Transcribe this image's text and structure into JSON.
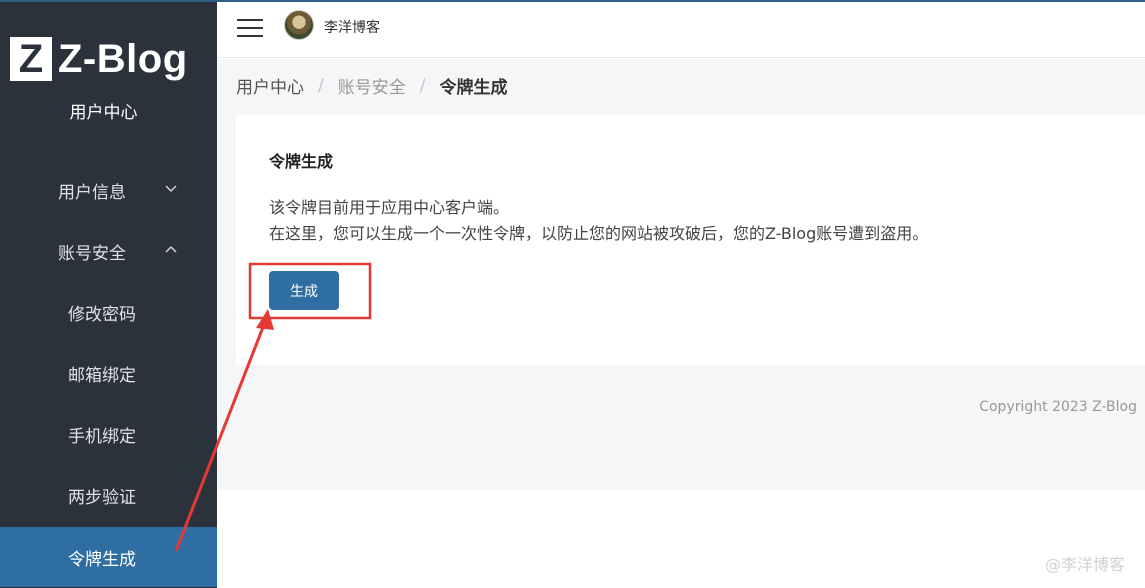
{
  "logo": {
    "mark": "Z",
    "text": "Z-Blog"
  },
  "sidebar": {
    "title": "用户中心",
    "items": [
      {
        "label": "用户信息",
        "chevron": "down"
      },
      {
        "label": "账号安全",
        "chevron": "up"
      }
    ],
    "sub_items": [
      {
        "label": "修改密码"
      },
      {
        "label": "邮箱绑定"
      },
      {
        "label": "手机绑定"
      },
      {
        "label": "两步验证"
      },
      {
        "label": "令牌生成",
        "active": true
      }
    ]
  },
  "header": {
    "site_name": "李洋博客"
  },
  "breadcrumb": {
    "root": "用户中心",
    "section": "账号安全",
    "current": "令牌生成"
  },
  "card": {
    "title": "令牌生成",
    "desc_line1": "该令牌目前用于应用中心客户端。",
    "desc_line2": "在这里，您可以生成一个一次性令牌，以防止您的网站被攻破后，您的Z-Blog账号遭到盗用。",
    "button_label": "生成"
  },
  "footer": {
    "copyright": "Copyright 2023 Z-Blog",
    "watermark": "@李洋博客"
  },
  "colors": {
    "sidebar_bg": "#2b323c",
    "accent": "#2e6ea3",
    "annotation_red": "#e53935"
  }
}
